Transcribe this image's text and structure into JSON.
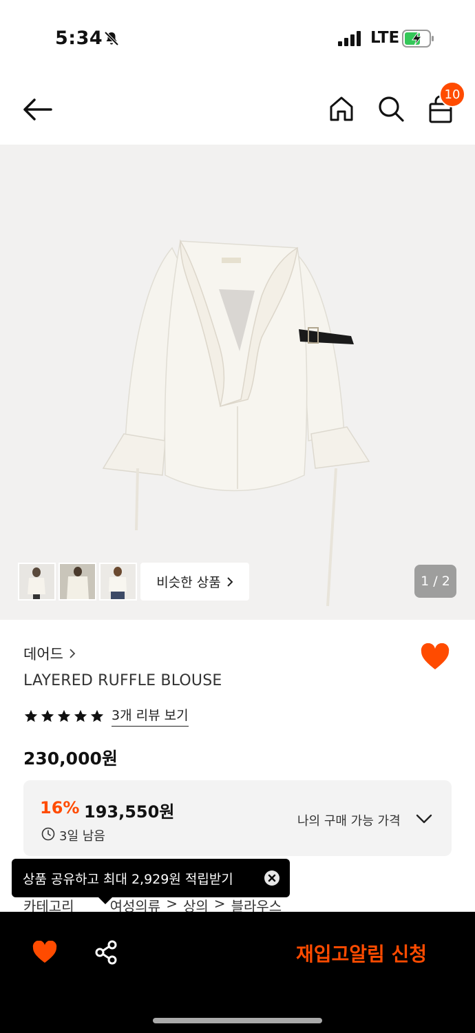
{
  "status_bar": {
    "time": "5:34",
    "network": "LTE"
  },
  "nav": {
    "cart_count": "10"
  },
  "gallery": {
    "similar_label": "비슷한 상품",
    "page_indicator": "1 / 2"
  },
  "product": {
    "brand": "데어드",
    "name": "LAYERED RUFFLE BLOUSE",
    "rating": 5,
    "review_link": "3개 리뷰 보기",
    "price": "230,000원"
  },
  "discount": {
    "percent": "16%",
    "price": "193,550원",
    "remaining": "3일 남음",
    "my_price_label": "나의 구매 가능 가격"
  },
  "category": {
    "label": "카테고리",
    "path": [
      "여성의류",
      "상의",
      "블라우스"
    ]
  },
  "tooltip": {
    "text": "상품 공유하고 최대 2,929원 적립받기"
  },
  "bottom_bar": {
    "restock_label": "재입고알림 신청"
  },
  "colors": {
    "accent": "#ff4b00",
    "background_image": "#f2f1f0",
    "dark": "#000000"
  },
  "icons": [
    "bell-slash-icon",
    "signal-icon",
    "battery-icon",
    "back-arrow-icon",
    "home-icon",
    "search-icon",
    "shopping-bag-icon",
    "heart-icon",
    "star-icon",
    "clock-icon",
    "chevron-down-icon",
    "close-icon",
    "share-icon"
  ]
}
